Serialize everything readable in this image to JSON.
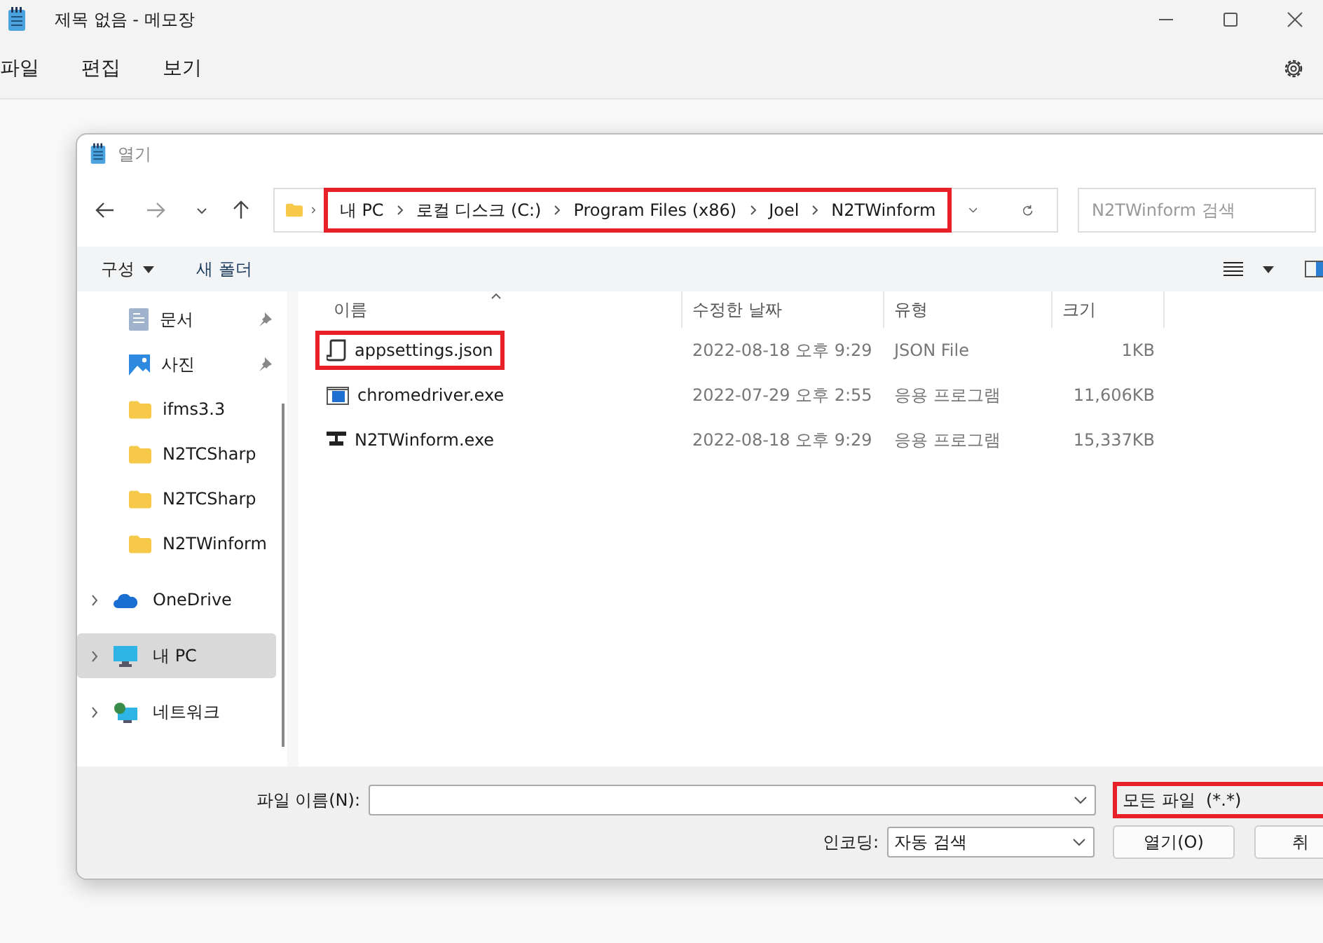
{
  "window": {
    "title": "제목 없음 - 메모장"
  },
  "menu": [
    "파일",
    "편집",
    "보기"
  ],
  "dialog": {
    "title": "열기",
    "breadcrumb": {
      "highlighted": true,
      "parts": [
        "내 PC",
        "로컬 디스크 (C:)",
        "Program Files (x86)",
        "Joel",
        "N2TWinform"
      ]
    },
    "search": {
      "placeholder": "N2TWinform 검색"
    },
    "toolbar": [
      {
        "label": "구성",
        "dropdown": true
      },
      {
        "label": "새 폴더",
        "dropdown": false
      }
    ],
    "sidebar": [
      {
        "label": "문서",
        "kind": "documents",
        "pinned": true,
        "expandable": false,
        "selected": false
      },
      {
        "label": "사진",
        "kind": "pictures",
        "pinned": true,
        "expandable": false,
        "selected": false
      },
      {
        "label": "ifms3.3",
        "kind": "folder",
        "pinned": false,
        "expandable": false,
        "selected": false
      },
      {
        "label": "N2TCSharp",
        "kind": "folder",
        "pinned": false,
        "expandable": false,
        "selected": false
      },
      {
        "label": "N2TCSharp",
        "kind": "folder",
        "pinned": false,
        "expandable": false,
        "selected": false
      },
      {
        "label": "N2TWinform",
        "kind": "folder",
        "pinned": false,
        "expandable": false,
        "selected": false
      },
      {
        "label": "OneDrive",
        "kind": "cloud",
        "pinned": false,
        "expandable": true,
        "selected": false
      },
      {
        "label": "내 PC",
        "kind": "pc",
        "pinned": false,
        "expandable": true,
        "selected": true
      },
      {
        "label": "네트워크",
        "kind": "network",
        "pinned": false,
        "expandable": true,
        "selected": false
      }
    ],
    "columns": [
      {
        "label": "이름",
        "sorted": true
      },
      {
        "label": "수정한 날짜",
        "sorted": false
      },
      {
        "label": "유형",
        "sorted": false
      },
      {
        "label": "크기",
        "sorted": false
      }
    ],
    "files": [
      {
        "name": "appsettings.json",
        "kind": "json",
        "date": "2022-08-18 오후 9:29",
        "type": "JSON File",
        "size": "1KB",
        "highlighted": true
      },
      {
        "name": "chromedriver.exe",
        "kind": "exe",
        "date": "2022-07-29 오후 2:55",
        "type": "응용 프로그램",
        "size": "11,606KB",
        "highlighted": false
      },
      {
        "name": "N2TWinform.exe",
        "kind": "app",
        "date": "2022-08-18 오후 9:29",
        "type": "응용 프로그램",
        "size": "15,337KB",
        "highlighted": false
      }
    ],
    "file_name": {
      "label": "파일 이름(N):"
    },
    "filter": {
      "value": "모든 파일  (*.*)",
      "highlighted": true
    },
    "encoding": {
      "label": "인코딩:",
      "value": "자동 검색"
    },
    "buttons": [
      "열기(O)",
      "취"
    ]
  }
}
